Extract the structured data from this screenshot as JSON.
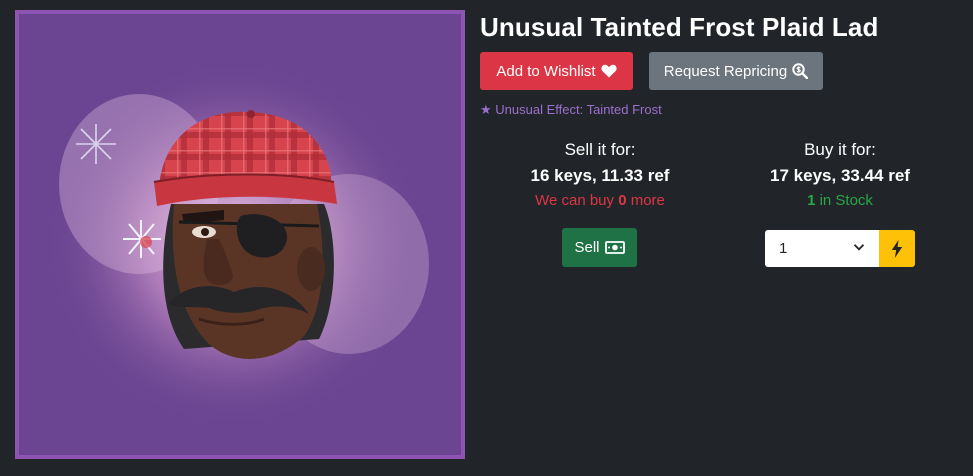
{
  "item": {
    "title": "Unusual Tainted Frost Plaid Lad",
    "image_alt": "Plaid Lad hat with Tainted Frost effect",
    "effect_prefix": "★",
    "effect_text": "Unusual Effect: Tainted Frost"
  },
  "actions": {
    "wishlist_label": "Add to Wishlist",
    "wishlist_icon": "heart-icon",
    "reprice_label": "Request Repricing",
    "reprice_icon": "magnifier-dollar-icon"
  },
  "sell": {
    "label": "Sell it for:",
    "price": "16 keys, 11.33 ref",
    "note_prefix": "We can buy",
    "note_count": "0",
    "note_suffix": "more",
    "button_label": "Sell",
    "button_icon": "money-bill-icon"
  },
  "buy": {
    "label": "Buy it for:",
    "price": "17 keys, 33.44 ref",
    "stock_count": "1",
    "stock_suffix": "in Stock",
    "quantity_value": "1",
    "instant_icon": "lightning-bolt-icon"
  },
  "colors": {
    "background": "#212529",
    "wishlist": "#dc3545",
    "reprice": "#6c757d",
    "sell": "#1e7245",
    "instant": "#ffc107",
    "effect": "#9b6fd0",
    "frame": "#8e54b3"
  }
}
